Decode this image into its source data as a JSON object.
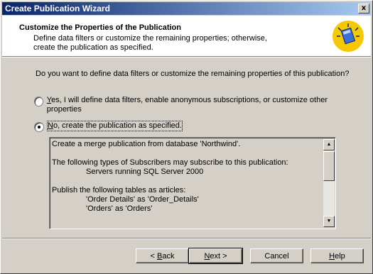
{
  "window": {
    "title": "Create Publication Wizard",
    "close_glyph": "x"
  },
  "header": {
    "title": "Customize the Properties of the Publication",
    "description": "Define data filters or customize the remaining properties; otherwise, create the publication as specified.",
    "icon": "publication-book-icon"
  },
  "question": "Do you want to define data filters or customize the remaining properties of this publication?",
  "options": [
    {
      "label_first": "Y",
      "label_rest": "es, I will define data filters, enable anonymous subscriptions, or customize other properties",
      "checked": false
    },
    {
      "label_first": "N",
      "label_rest": "o, create the publication as specified.",
      "checked": true
    }
  ],
  "summary": {
    "line1": "Create a merge publication from database 'Northwind'.",
    "line2": "The following types of Subscribers may subscribe to this publication:",
    "line3": "Servers running SQL Server 2000",
    "line4": "Publish the following tables as articles:",
    "line5": "'Order Details' as 'Order_Details'",
    "line6": "'Orders' as 'Orders'"
  },
  "buttons": {
    "back_prefix": "< ",
    "back_u": "B",
    "back_rest": "ack",
    "next_u": "N",
    "next_rest": "ext >",
    "cancel": "Cancel",
    "help_u": "H",
    "help_rest": "elp"
  },
  "colors": {
    "titlebar_start": "#0a246a",
    "titlebar_end": "#a6caf0",
    "face": "#d4d0c8",
    "icon_circle": "#f5c800"
  }
}
